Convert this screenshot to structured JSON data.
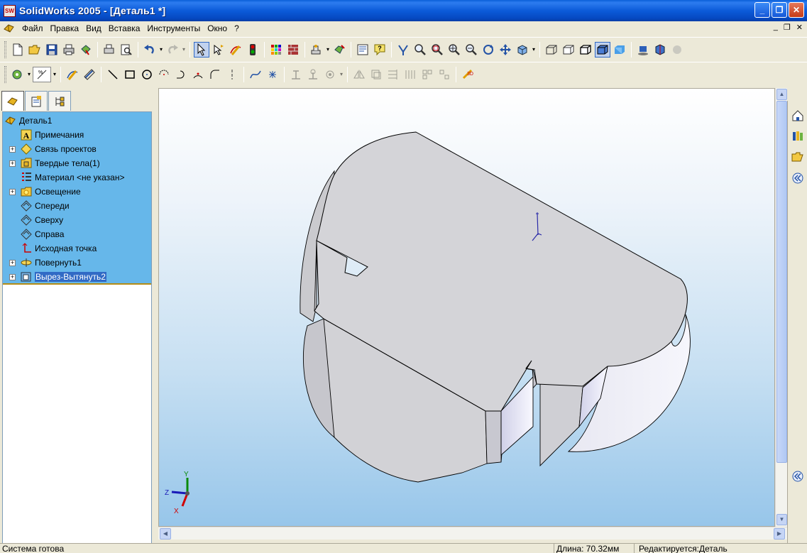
{
  "window": {
    "title": "SolidWorks 2005 - [Деталь1 *]",
    "app_icon_text": "SW",
    "minimize_glyph": "_",
    "maximize_glyph": "❐",
    "close_glyph": "✕"
  },
  "menu": {
    "items": [
      "Файл",
      "Правка",
      "Вид",
      "Вставка",
      "Инструменты",
      "Окно",
      "?"
    ],
    "mdi": [
      "_",
      "❐",
      "✕"
    ]
  },
  "toolbar_standard": {
    "icons": [
      "new-icon",
      "open-icon",
      "save-icon",
      "print-icon",
      "print-preview-icon",
      "rebuild-icon",
      "undo-icon",
      "redo-icon",
      "select-icon",
      "smart-select-icon",
      "sketch-icon",
      "traffic-light-icon",
      "color-icon",
      "texture-icon",
      "options-icon",
      "help-icon"
    ]
  },
  "toolbar_view": {
    "icons": [
      "zoom-to-fit-icon",
      "zoom-area-icon",
      "zoom-in-out-icon",
      "zoom-selection-icon",
      "rotate-icon",
      "pan-icon",
      "view-orientation-icon",
      "wireframe-icon",
      "hidden-lines-visible-icon",
      "hidden-lines-removed-icon",
      "shaded-with-edges-icon",
      "shaded-icon",
      "shadow-icon",
      "perspective-icon"
    ],
    "active": "shaded-with-edges-icon"
  },
  "toolbar_sketch": {
    "icons": [
      "sketch-icon",
      "smart-dimension-icon",
      "line-icon",
      "rectangle-icon",
      "circle-icon",
      "center-arc-icon",
      "tangent-arc-icon",
      "three-point-arc-icon",
      "fillet-icon",
      "centerline-icon",
      "spline-icon",
      "point-icon",
      "add-relation-icon",
      "display-relations-icon",
      "convert-entities-icon",
      "mirror-icon",
      "trim-icon",
      "extend-icon",
      "offset-icon",
      "linear-pattern-icon",
      "rapid-sketch-icon"
    ]
  },
  "feature_manager": {
    "tabs": [
      "feature-tree-tab",
      "property-manager-tab",
      "configuration-manager-tab"
    ],
    "items": [
      {
        "label": "Деталь1",
        "icon": "part-icon",
        "expandable": false,
        "indent": 0
      },
      {
        "label": "Примечания",
        "icon": "annotations-icon",
        "expandable": false,
        "indent": 1
      },
      {
        "label": "Связь проектов",
        "icon": "design-binder-icon",
        "expandable": true,
        "indent": 1
      },
      {
        "label": "Твердые тела(1)",
        "icon": "solid-bodies-icon",
        "expandable": true,
        "indent": 1
      },
      {
        "label": "Материал <не указан>",
        "icon": "material-icon",
        "expandable": false,
        "indent": 1
      },
      {
        "label": "Освещение",
        "icon": "lighting-icon",
        "expandable": true,
        "indent": 1
      },
      {
        "label": "Спереди",
        "icon": "plane-icon",
        "expandable": false,
        "indent": 1
      },
      {
        "label": "Сверху",
        "icon": "plane-icon",
        "expandable": false,
        "indent": 1
      },
      {
        "label": "Справа",
        "icon": "plane-icon",
        "expandable": false,
        "indent": 1
      },
      {
        "label": "Исходная точка",
        "icon": "origin-icon",
        "expandable": false,
        "indent": 1
      },
      {
        "label": "Повернуть1",
        "icon": "revolve-icon",
        "expandable": true,
        "indent": 1
      },
      {
        "label": "Вырез-Вытянуть2",
        "icon": "cut-extrude-icon",
        "expandable": true,
        "indent": 1,
        "selected": true
      }
    ]
  },
  "triad": {
    "x": "X",
    "y": "Y",
    "z": "Z"
  },
  "task_pane": {
    "icons": [
      "resources-icon",
      "design-library-icon",
      "file-explorer-icon",
      "collapse-icon",
      "expand-icon"
    ]
  },
  "status": {
    "text": "Система готова",
    "length": "Длина: 70.32мм",
    "mode": "Редактируется:Деталь"
  },
  "colors": {
    "title_bar": "#0c5bd9",
    "tree_highlight": "#66b7ea",
    "selection": "#316ac5",
    "model_face": "#d4d4d8",
    "background_bottom": "#97c6ea"
  }
}
